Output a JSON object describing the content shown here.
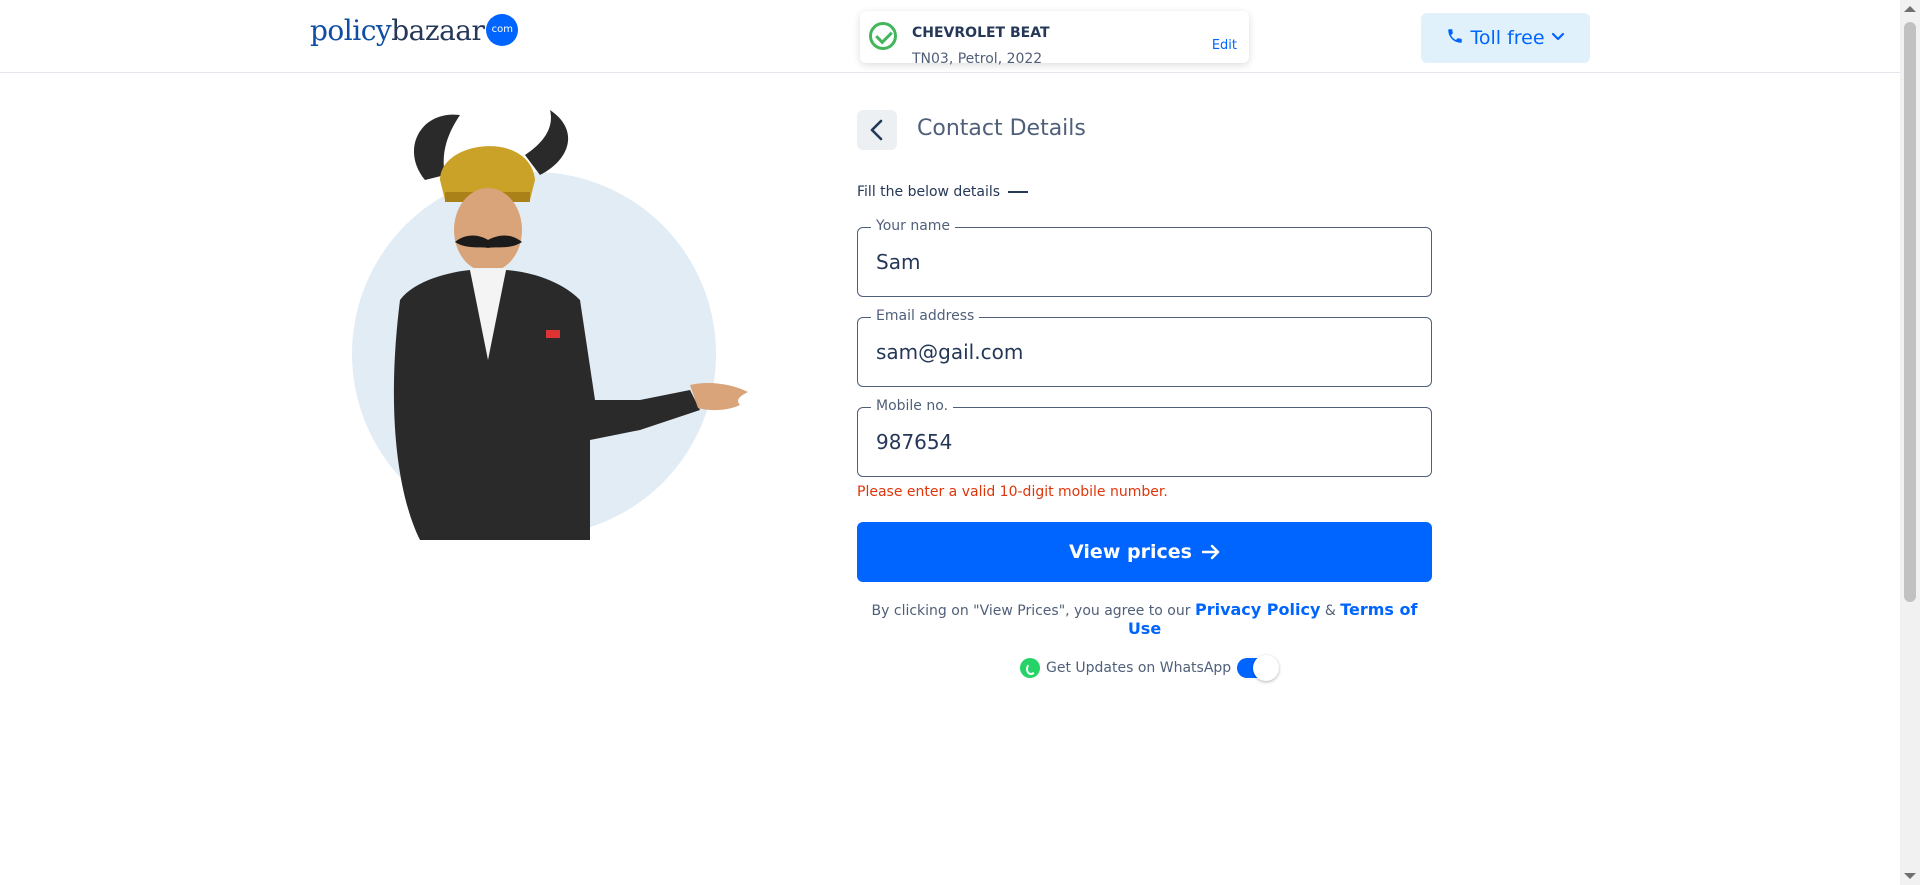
{
  "header": {
    "logo": {
      "part1": "policy",
      "part2": "bazaar",
      "badge": "com"
    },
    "vehicle": {
      "model": "CHEVROLET BEAT",
      "details": "TN03, Petrol, 2022",
      "edit_label": "Edit",
      "status_icon": "check-circle-icon"
    },
    "toll_free": {
      "label": "Toll free",
      "icon": "phone-icon",
      "chevron": "chevron-down-icon"
    }
  },
  "hero": {
    "image": "mascot-in-suit-pointing",
    "bg_color": "#e1ecf4"
  },
  "form": {
    "title": "Contact Details",
    "subtitle": "Fill the below details",
    "fields": [
      {
        "label": "Your name",
        "value": "Sam"
      },
      {
        "label": "Email address",
        "value": "sam@gail.com"
      },
      {
        "label": "Mobile no.",
        "value": "987654"
      }
    ],
    "error": "Please enter a valid 10-digit mobile number.",
    "cta_label": "View prices",
    "terms_prefix": "By clicking on \"View Prices\", you agree to our",
    "privacy_label": "Privacy Policy",
    "amp": "&",
    "terms_label": "Terms of Use",
    "whatsapp_label": "Get Updates on WhatsApp",
    "whatsapp_enabled": true
  },
  "colors": {
    "primary": "#0065ff",
    "error": "#de350b",
    "success": "#43b55b",
    "text": "#253858"
  }
}
